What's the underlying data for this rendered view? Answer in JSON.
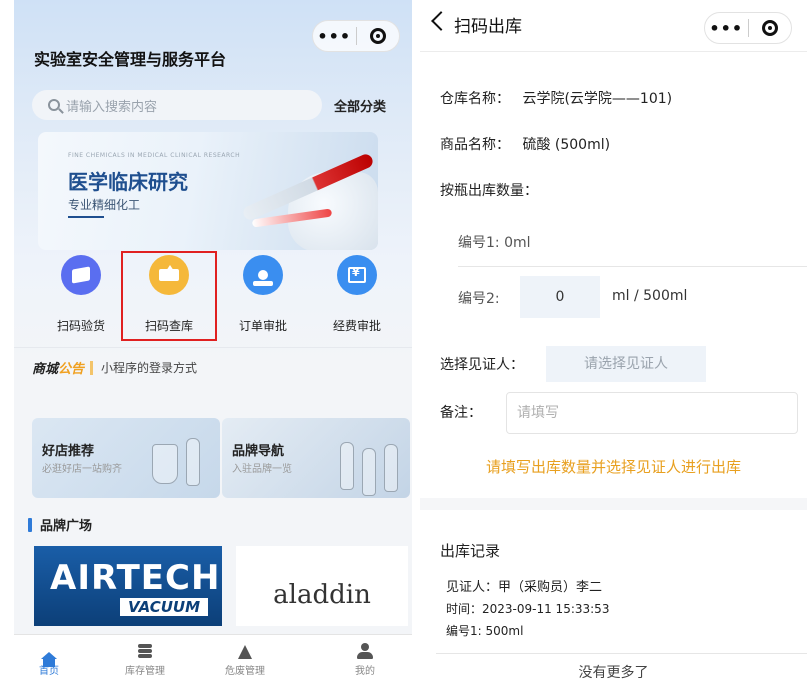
{
  "left": {
    "title": "实验室安全管理与服务平台",
    "search": {
      "placeholder": "请输入搜索内容"
    },
    "all_categories": "全部分类",
    "banner": {
      "small_text": "FINE CHEMICALS IN MEDICAL CLINICAL RESEARCH",
      "big_text": "医学临床研究",
      "sub_text": "专业精细化工"
    },
    "quick_actions": [
      {
        "label": "扫码验货",
        "icon": "cube-icon",
        "color": "#5a6ef0"
      },
      {
        "label": "扫码查库",
        "icon": "tray-upload-icon",
        "color": "#f5b83a"
      },
      {
        "label": "订单审批",
        "icon": "stamp-icon",
        "color": "#3a8ef0"
      },
      {
        "label": "经费审批",
        "icon": "money-icon",
        "color": "#3a8ef0"
      }
    ],
    "notice": {
      "tag_part1": "商城",
      "tag_part2": "公告",
      "text": "小程序的登录方式"
    },
    "cards": [
      {
        "title": "好店推荐",
        "subtitle": "必逛好店一站购齐"
      },
      {
        "title": "品牌导航",
        "subtitle": "入驻品牌一览"
      }
    ],
    "section_title": "品牌广场",
    "brands": [
      {
        "line1": "AIRTECH",
        "line2": "VACUUM"
      },
      {
        "name": "aladdin"
      }
    ],
    "tabs": [
      {
        "label": "首页",
        "icon": "home-icon",
        "active": true
      },
      {
        "label": "库存管理",
        "icon": "layers-icon",
        "active": false
      },
      {
        "label": "危废管理",
        "icon": "beaker-icon",
        "active": false
      },
      {
        "label": "我的",
        "icon": "person-icon",
        "active": false
      }
    ]
  },
  "right": {
    "nav_title": "扫码出库",
    "warehouse": {
      "label": "仓库名称：",
      "value": "云学院(云学院——101)"
    },
    "product": {
      "label": "商品名称：",
      "value": "硫酸 (500ml)"
    },
    "qty_label": "按瓶出库数量：",
    "items": [
      {
        "label": "编号1:",
        "value": "0ml"
      },
      {
        "label": "编号2:",
        "input_value": "0",
        "unit": "ml / 500ml"
      }
    ],
    "witness": {
      "label": "选择见证人：",
      "placeholder": "请选择见证人"
    },
    "remark": {
      "label": "备注：",
      "placeholder": "请填写"
    },
    "warning": "请填写出库数量并选择见证人进行出库",
    "records": {
      "title": "出库记录",
      "witness_line": "见证人：甲（采购员）李二",
      "time_line": "时间：2023-09-11 15:33:53",
      "item_line": "编号1: 500ml",
      "no_more": "没有更多了"
    }
  },
  "colors": {
    "accent": "#2f7bd8",
    "warning": "#e8a020",
    "highlight_border": "#e02020"
  }
}
